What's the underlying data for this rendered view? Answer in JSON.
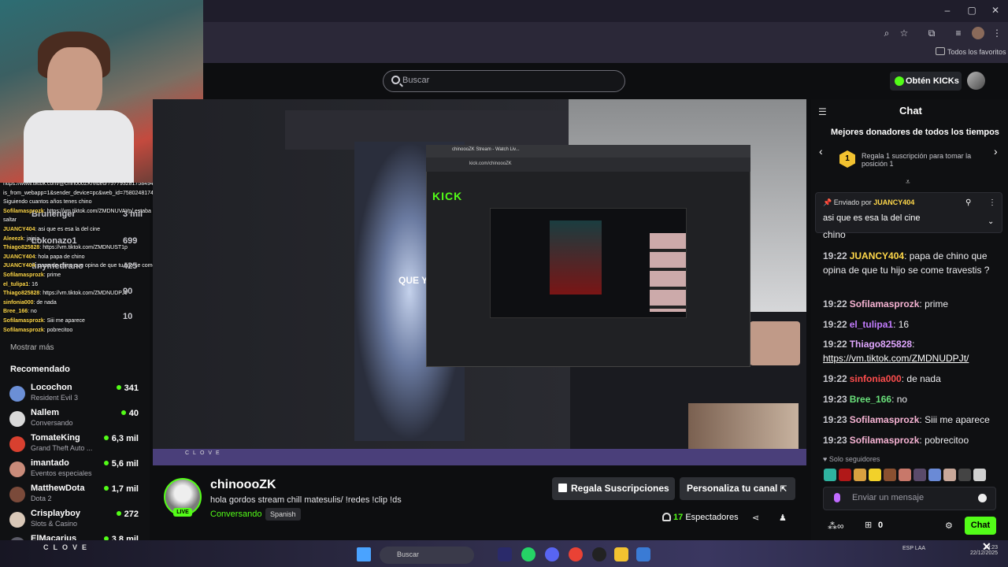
{
  "browser": {
    "bookmarks_label": "Todos los favoritos"
  },
  "header": {
    "search_placeholder": "Buscar",
    "kicks_button": "Obtén KICKs"
  },
  "sidebar": {
    "overlay_chat": [
      {
        "user": "",
        "text": "https://www.tiktok.com/@chinoooZK/video/7577932817584947..."
      },
      {
        "user": "",
        "text": "is_from_webapp=1&sender_device=pc&web_id=7580248174167295544 gordo ??"
      },
      {
        "user": "",
        "text": "Siguiendo   cuantos años tenes chino"
      },
      {
        "user": "Sofilamasprozk",
        "text": ": https://vm.tiktok.com/ZMDNUVAYp/ estaba cagando y me pare para"
      },
      {
        "user": "",
        "text": "saltar"
      },
      {
        "user": "JUANCY404",
        "text": ": asi que es esa la del cine"
      },
      {
        "user": "Aleeezk",
        "text": ": jajaja"
      },
      {
        "user": "Thiago825828",
        "text": ": https://vm.tiktok.com/ZMDNUST1p"
      },
      {
        "user": "JUANCY404",
        "text": ": hola papa de chino"
      },
      {
        "user": "JUANCY404",
        "text": ": papa de chino que opina de que tu hijo se come travestis ?"
      },
      {
        "user": "Sofilamasprozk",
        "text": ": prime"
      },
      {
        "user": "el_tulipa1",
        "text": ": 16"
      },
      {
        "user": "Thiago825828",
        "text": ": https://vm.tiktok.com/ZMDNUDPJt/"
      },
      {
        "user": "sinfonia000",
        "text": ": de nada"
      },
      {
        "user": "Bree_166",
        "text": ": no"
      },
      {
        "user": "Sofilamasprozk",
        "text": ": Siii me aparece"
      },
      {
        "user": "Sofilamasprozk",
        "text": ": pobrecitoo"
      }
    ],
    "ghost_following": [
      {
        "name": "Brunenger",
        "count": "3 mil"
      },
      {
        "name": "Lokonazo1",
        "count": "699"
      },
      {
        "name": "tinymedrano",
        "count": "425"
      },
      {
        "name": "",
        "count": "90"
      },
      {
        "name": "",
        "count": "10"
      }
    ],
    "show_more": "Mostrar más",
    "recommended_title": "Recomendado",
    "recommended": [
      {
        "name": "Locochon",
        "category": "Resident Evil 3",
        "viewers": "341",
        "color": "#6b8fd6"
      },
      {
        "name": "Nallem",
        "category": "Conversando",
        "viewers": "40",
        "color": "#d9d9d9"
      },
      {
        "name": "TomateKing",
        "category": "Grand Theft Auto ...",
        "viewers": "6,3 mil",
        "color": "#d8402f"
      },
      {
        "name": "imantado",
        "category": "Eventos especiales",
        "viewers": "5,6 mil",
        "color": "#c98b7a"
      },
      {
        "name": "MatthewDota",
        "category": "Dota 2",
        "viewers": "1,7 mil",
        "color": "#7a4a3a"
      },
      {
        "name": "Crisplayboy",
        "category": "Slots & Casino",
        "viewers": "272",
        "color": "#d9c8b8"
      },
      {
        "name": "ElMacarius",
        "category": "",
        "viewers": "3,8 mil",
        "color": "#5a5a66"
      }
    ]
  },
  "video": {
    "caption": "QUE Y",
    "inner_logo": "KICK",
    "inner_url": "kick.com/chinoooZK",
    "inner_tab": "chinoooZK Stream - Watch Liv...",
    "brand": "CLOVE"
  },
  "stream": {
    "streamer": "chinoooZK",
    "live": "LIVE",
    "title": "hola gordos stream chill matesulis/ !redes !clip !ds",
    "category": "Conversando",
    "language": "Spanish",
    "gift_button": "Regala Suscripciones",
    "customize_button": "Personaliza tu canal",
    "viewers_count": "17",
    "viewers_label": "Espectadores"
  },
  "chat": {
    "title": "Chat",
    "donors_title": "Mejores donadores de todos los tiempos",
    "donor_rank": "1",
    "donor_text": "Regala 1 suscripción para tomar la posición 1",
    "pinned_by_label": "Enviado por",
    "pinned_user": "JUANCY404",
    "pinned_message": "asi que es esa la del cine",
    "partial_text": "chino",
    "messages": [
      {
        "time": "19:22",
        "user": "JUANCY404",
        "color": "#ffd84a",
        "text": ": papa de chino que opina de que tu hijo se come travestis ?",
        "link": ""
      },
      {
        "time": "19:22",
        "user": "Sofilamasprozk",
        "color": "#f6b3d3",
        "text": ": prime",
        "link": ""
      },
      {
        "time": "19:22",
        "user": "el_tulipa1",
        "color": "#c37cff",
        "text": ": 16",
        "link": ""
      },
      {
        "time": "19:22",
        "user": "Thiago825828",
        "color": "#e0a7ff",
        "text": ":",
        "link": "https://vm.tiktok.com/ZMDNUDPJt/"
      },
      {
        "time": "19:22",
        "user": "sinfonia000",
        "color": "#ff4d4d",
        "text": ": de nada",
        "link": ""
      },
      {
        "time": "19:23",
        "user": "Bree_166",
        "color": "#69e07a",
        "text": ": no",
        "link": ""
      },
      {
        "time": "19:23",
        "user": "Sofilamasprozk",
        "color": "#f6b3d3",
        "text": ": Siii me aparece",
        "link": ""
      },
      {
        "time": "19:23",
        "user": "Sofilamasprozk",
        "color": "#f6b3d3",
        "text": ": pobrecitoo",
        "link": ""
      }
    ],
    "followers_only": "Solo seguidores",
    "input_placeholder": "Enviar un mensaje",
    "box_count": "0",
    "send_button": "Chat",
    "emote_colors": [
      "#2fb3a0",
      "#b01818",
      "#d9a040",
      "#f2d12a",
      "#8a5030",
      "#c8786a",
      "#5a4a6a",
      "#6a8ad6",
      "#c9a89a",
      "#444",
      "#d0d0d0"
    ]
  },
  "taskbar": {
    "brand": "CLOVE",
    "search": "Buscar",
    "language": "ESP LAA",
    "time": "19:23",
    "date": "22/12/2025"
  },
  "colors": {
    "accent": "#53fc18"
  }
}
